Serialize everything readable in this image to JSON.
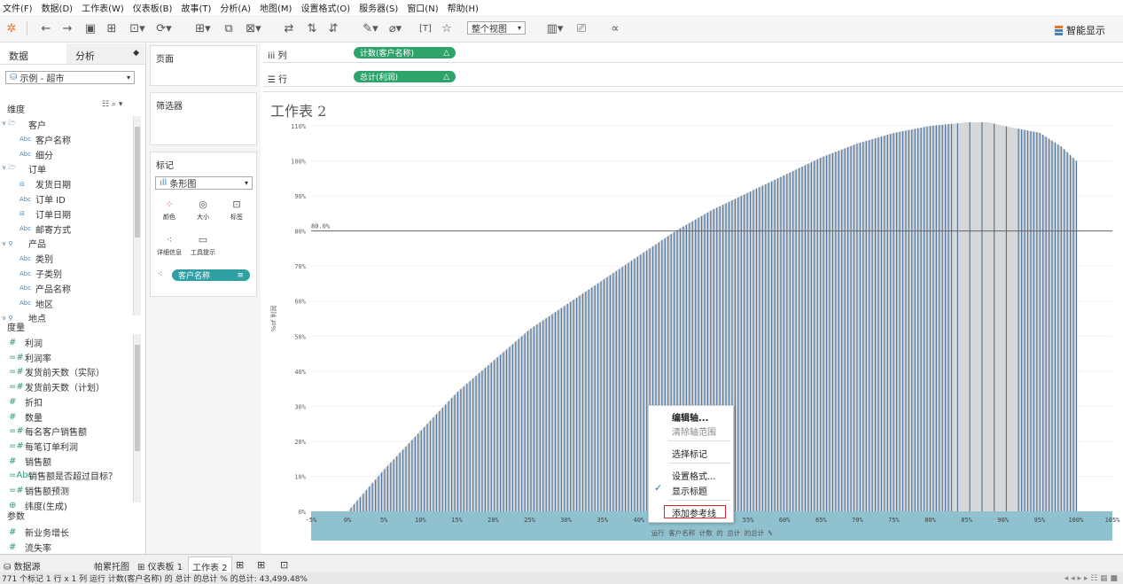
{
  "menu": [
    "文件(F)",
    "数据(D)",
    "工作表(W)",
    "仪表板(B)",
    "故事(T)",
    "分析(A)",
    "地图(M)",
    "设置格式(O)",
    "服务器(S)",
    "窗口(N)",
    "帮助(H)"
  ],
  "toolbar": {
    "view_select": "整个视图",
    "smart_display": "智能显示"
  },
  "datapane": {
    "tab_data": "数据",
    "tab_analysis": "分析",
    "source": "示例 - 超市",
    "dimensions_header": "维度",
    "dimensions": [
      {
        "label": "客户",
        "type": "folder"
      },
      {
        "label": "客户名称",
        "type": "Abc"
      },
      {
        "label": "细分",
        "type": "Abc"
      },
      {
        "label": "订单",
        "type": "folder"
      },
      {
        "label": "发货日期",
        "type": "date"
      },
      {
        "label": "订单 ID",
        "type": "Abc"
      },
      {
        "label": "订单日期",
        "type": "date"
      },
      {
        "label": "邮寄方式",
        "type": "Abc"
      },
      {
        "label": "产品",
        "type": "hier"
      },
      {
        "label": "类别",
        "type": "Abc"
      },
      {
        "label": "子类别",
        "type": "Abc"
      },
      {
        "label": "产品名称",
        "type": "Abc"
      },
      {
        "label": "地区",
        "type": "Abc"
      },
      {
        "label": "地点",
        "type": "hier"
      }
    ],
    "measures_header": "度量",
    "measures": [
      {
        "label": "利润",
        "type": "#"
      },
      {
        "label": "利润率",
        "type": "=#"
      },
      {
        "label": "发货前天数（实际）",
        "type": "=#"
      },
      {
        "label": "发货前天数（计划）",
        "type": "=#"
      },
      {
        "label": "折扣",
        "type": "#"
      },
      {
        "label": "数量",
        "type": "#"
      },
      {
        "label": "每名客户销售额",
        "type": "=#"
      },
      {
        "label": "每笔订单利润",
        "type": "=#"
      },
      {
        "label": "销售额",
        "type": "#"
      },
      {
        "label": "销售额是否超过目标？",
        "type": "=Abc"
      },
      {
        "label": "销售额预测",
        "type": "=#"
      },
      {
        "label": "纬度(生成)",
        "type": "geo"
      }
    ],
    "params_header": "参数",
    "params": [
      {
        "label": "新业务增长",
        "type": "#"
      },
      {
        "label": "流失率",
        "type": "#"
      }
    ]
  },
  "cards": {
    "pages": "页面",
    "filters": "筛选器",
    "marks": "标记",
    "mark_type": "条形图",
    "color": "颜色",
    "size": "大小",
    "label": "标签",
    "detail": "详细信息",
    "tooltip": "工具提示",
    "detail_pill": "客户名称"
  },
  "shelves": {
    "columns_label": "列",
    "columns_pill": "计数(客户名称)",
    "rows_label": "行",
    "rows_pill": "总计(利润)"
  },
  "sheet_title": "工作表 2",
  "context_menu": {
    "edit_axis": "编辑轴...",
    "clear_range": "清除轴范围",
    "select_marks": "选择标记",
    "format": "设置格式...",
    "show_title": "显示标题",
    "add_ref_line": "添加参考线"
  },
  "chart_data": {
    "type": "bar",
    "ylabel": "%of 利润",
    "xlabel": "运行 客户名称 计数 的 总计 的总计 %",
    "x_ticks": [
      "-5%",
      "0%",
      "5%",
      "10%",
      "15%",
      "20%",
      "25%",
      "30%",
      "35%",
      "40%",
      "45%",
      "50%",
      "55%",
      "60%",
      "65%",
      "70%",
      "75%",
      "80%",
      "85%",
      "90%",
      "95%",
      "100%",
      "105%"
    ],
    "y_ticks": [
      "0%",
      "10%",
      "20%",
      "30%",
      "40%",
      "50%",
      "60%",
      "70%",
      "80%",
      "90%",
      "100%",
      "110%"
    ],
    "xlim": [
      -5,
      105
    ],
    "ylim": [
      0,
      110
    ],
    "reference_line": {
      "value": 80,
      "label": "80.0%"
    },
    "bar_color": "#4e79a7",
    "highlight_band": [
      83,
      92
    ],
    "series_points": {
      "x": [
        0,
        5,
        10,
        15,
        20,
        25,
        30,
        35,
        40,
        45,
        50,
        55,
        60,
        65,
        70,
        75,
        80,
        85,
        88,
        90,
        95,
        98,
        100
      ],
      "y": [
        0,
        12,
        23,
        34,
        43,
        52,
        59,
        66,
        73,
        80,
        86,
        91,
        96,
        101,
        105,
        108,
        110,
        111,
        111,
        110,
        108,
        104,
        100
      ]
    }
  },
  "sheet_tabs": {
    "datasource": "数据源",
    "t1": "帕累托图",
    "t2": "仪表板 1",
    "t3": "工作表 2"
  },
  "status": "771 个标记    1 行 x 1 列    运行 计数(客户名称) 的 总计 的总计 % 的总计: 43,499.48%"
}
